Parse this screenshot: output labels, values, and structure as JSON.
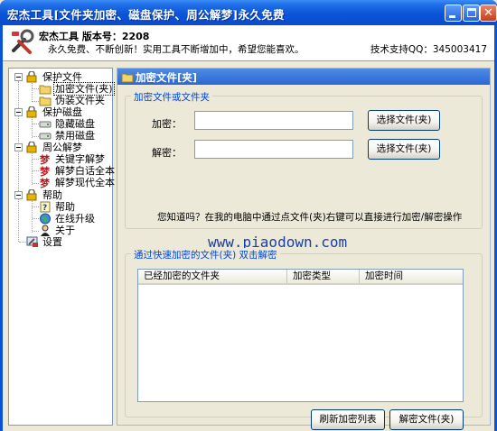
{
  "window": {
    "title": "宏杰工具[文件夹加密、磁盘保护、周公解梦]永久免费"
  },
  "header": {
    "app_name_version": "宏杰工具  版本号：2208",
    "slogan": "永久免费、不断创新！实用工具不断增加中，希望您能喜欢。",
    "support_qq": "技术支持QQ：345003417"
  },
  "tree": {
    "groups": [
      {
        "label": "保护文件",
        "icon": "lock-folder-icon",
        "children": [
          {
            "label": "加密文件(夹)",
            "icon": "folder-icon",
            "selected": true
          },
          {
            "label": "伪装文件夹",
            "icon": "folder-icon"
          }
        ]
      },
      {
        "label": "保护磁盘",
        "icon": "lock-folder-icon",
        "children": [
          {
            "label": "隐藏磁盘",
            "icon": "drive-icon"
          },
          {
            "label": "禁用磁盘",
            "icon": "drive-icon"
          }
        ]
      },
      {
        "label": "周公解梦",
        "icon": "lock-folder-icon",
        "children": [
          {
            "label": "关键字解梦",
            "icon": "dream-icon"
          },
          {
            "label": "解梦白话全本",
            "icon": "dream-icon"
          },
          {
            "label": "解梦现代全本",
            "icon": "dream-icon"
          }
        ]
      },
      {
        "label": "帮助",
        "icon": "lock-folder-icon",
        "children": [
          {
            "label": "帮助",
            "icon": "help-icon"
          },
          {
            "label": "在线升级",
            "icon": "globe-icon"
          },
          {
            "label": "关于",
            "icon": "person-icon"
          }
        ]
      }
    ],
    "settings": {
      "label": "设置",
      "icon": "settings-icon"
    }
  },
  "panel": {
    "title": "加密文件[夹]",
    "group1_legend": "加密文件或文件夹",
    "encrypt_label": "加密：",
    "encrypt_value": "",
    "decrypt_label": "解密：",
    "decrypt_value": "",
    "choose_button": "选择文件(夹)",
    "choose_button2": "选择文件(夹)",
    "tip": "您知道吗？在我的电脑中通过点文件(夹)右键可以直接进行加密/解密操作",
    "watermark": "www.piaodown.com",
    "group2_legend": "通过快速加密的文件(夹) 双击解密",
    "columns": [
      "已经加密的文件夹",
      "加密类型",
      "加密时间"
    ],
    "rows": [],
    "refresh_button": "刷新加密列表",
    "decrypt_button": "解密文件(夹)"
  },
  "colors": {
    "titlebar": "#0a53d6",
    "panel_header": "#2c66d2",
    "legend_text": "#0046d5",
    "watermark": "#1a3fa8"
  }
}
